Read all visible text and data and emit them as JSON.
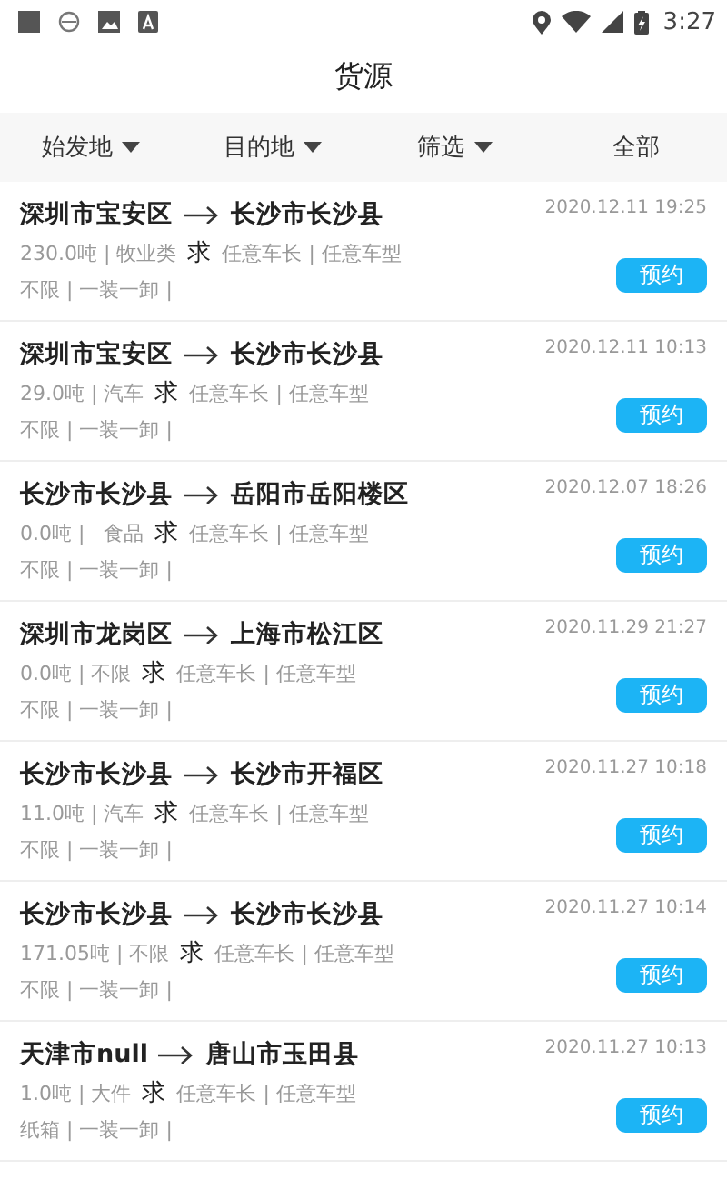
{
  "status_bar": {
    "time": "3:27"
  },
  "title": "货源",
  "filters": [
    {
      "label": "始发地",
      "kind": "dropdown"
    },
    {
      "label": "目的地",
      "kind": "dropdown"
    },
    {
      "label": "筛选",
      "kind": "dropdown"
    },
    {
      "label": "全部",
      "kind": "plain"
    }
  ],
  "listings": [
    {
      "from": "深圳市宝安区",
      "to": "长沙市长沙县",
      "date": "2020.12.11 19:25",
      "cargo": "230.0吨 | 牧业类",
      "request": "求",
      "vehicle": "任意车长 | 任意车型",
      "terms": "不限 | 一装一卸 |",
      "button": "预约"
    },
    {
      "from": "深圳市宝安区",
      "to": "长沙市长沙县",
      "date": "2020.12.11 10:13",
      "cargo": "29.0吨 | 汽车",
      "request": "求",
      "vehicle": "任意车长 | 任意车型",
      "terms": "不限 | 一装一卸 |",
      "button": "预约"
    },
    {
      "from": "长沙市长沙县",
      "to": "岳阳市岳阳楼区",
      "date": "2020.12.07 18:26",
      "cargo": "0.0吨 |   食品",
      "request": "求",
      "vehicle": "任意车长 | 任意车型",
      "terms": "不限 | 一装一卸 |",
      "button": "预约"
    },
    {
      "from": "深圳市龙岗区",
      "to": "上海市松江区",
      "date": "2020.11.29 21:27",
      "cargo": "0.0吨 | 不限",
      "request": "求",
      "vehicle": "任意车长 | 任意车型",
      "terms": "不限 | 一装一卸 |",
      "button": "预约"
    },
    {
      "from": "长沙市长沙县",
      "to": "长沙市开福区",
      "date": "2020.11.27 10:18",
      "cargo": "11.0吨 | 汽车",
      "request": "求",
      "vehicle": "任意车长 | 任意车型",
      "terms": "不限 | 一装一卸 |",
      "button": "预约"
    },
    {
      "from": "长沙市长沙县",
      "to": "长沙市长沙县",
      "date": "2020.11.27 10:14",
      "cargo": "171.05吨 | 不限",
      "request": "求",
      "vehicle": "任意车长 | 任意车型",
      "terms": "不限 | 一装一卸 |",
      "button": "预约"
    },
    {
      "from": "天津市null",
      "to": "唐山市玉田县",
      "date": "2020.11.27 10:13",
      "cargo": "1.0吨 | 大件",
      "request": "求",
      "vehicle": "任意车长 | 任意车型",
      "terms": "纸箱 | 一装一卸 |",
      "button": "预约"
    }
  ]
}
